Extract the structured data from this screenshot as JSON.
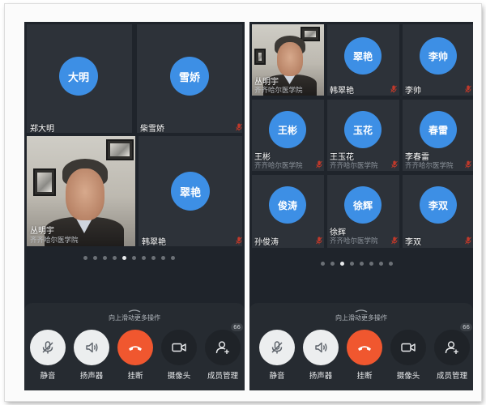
{
  "left": {
    "tiles": [
      {
        "name": "郑大明",
        "avatar": "大明",
        "muted": false
      },
      {
        "name": "柴雪娇",
        "avatar": "雪娇",
        "muted": true
      },
      {
        "name": "丛明宇",
        "org": "齐齐哈尔医学院",
        "video": true,
        "muted": false
      },
      {
        "name": "韩翠艳",
        "avatar": "翠艳",
        "muted": true
      }
    ],
    "pager": {
      "total": 10,
      "current": 5
    }
  },
  "right": {
    "tiles": [
      {
        "name": "丛明宇",
        "org": "齐齐哈尔医学院",
        "video": true,
        "muted": false
      },
      {
        "name": "韩翠艳",
        "avatar": "翠艳",
        "muted": true
      },
      {
        "name": "李帅",
        "avatar": "李帅",
        "muted": true
      },
      {
        "name": "王彬",
        "org": "齐齐哈尔医学院",
        "avatar": "王彬",
        "muted": true
      },
      {
        "name": "王玉花",
        "org": "齐齐哈尔医学院",
        "avatar": "玉花",
        "muted": true
      },
      {
        "name": "李春雷",
        "org": "齐齐哈尔医学院",
        "avatar": "春雷",
        "muted": true
      },
      {
        "name": "孙俊涛",
        "avatar": "俊涛",
        "muted": true
      },
      {
        "name": "徐辉",
        "org": "齐齐哈尔医学院",
        "avatar": "徐辉",
        "muted": true
      },
      {
        "name": "李双",
        "avatar": "李双",
        "muted": true
      }
    ],
    "pager": {
      "total": 8,
      "current": 3
    }
  },
  "controls": {
    "hint": "向上滑动更多操作",
    "mute_label": "静音",
    "speaker_label": "扬声器",
    "hangup_label": "挂断",
    "camera_label": "摄像头",
    "members_label": "成员管理",
    "members_count": "66"
  },
  "icons": {
    "mute": "mic-slash-icon",
    "speaker": "speaker-icon",
    "hangup": "phone-hangup-icon",
    "camera": "video-camera-icon",
    "members": "add-member-icon",
    "tile_mic": "mic-muted-icon"
  },
  "colors": {
    "background": "#1f242b",
    "tile": "#2d3239",
    "avatar": "#3d8fe5",
    "hangup": "#f0572f",
    "muted_mic": "#c0392b"
  }
}
